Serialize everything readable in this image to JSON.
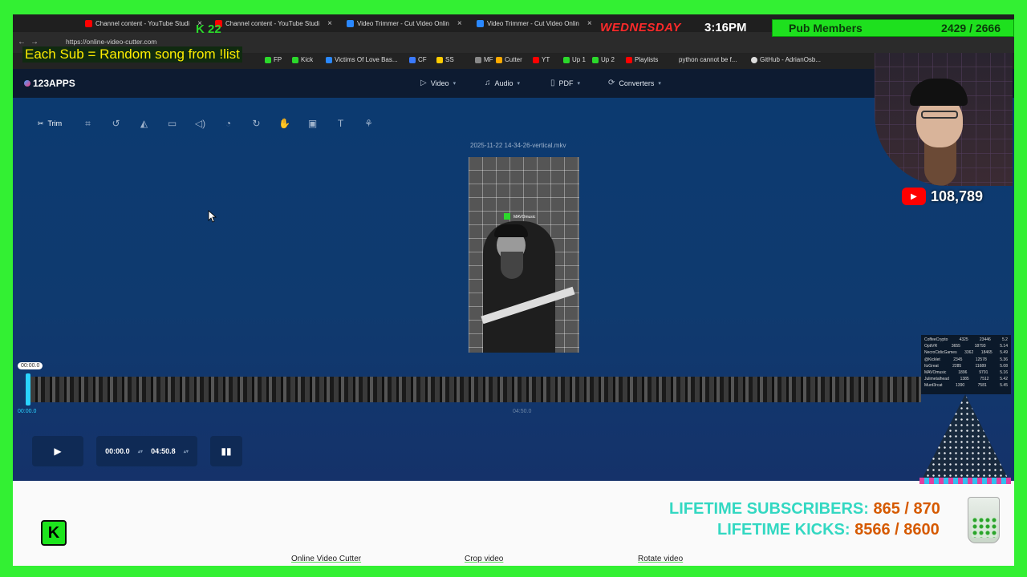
{
  "browser": {
    "tabs": [
      {
        "label": "Channel content - YouTube Studi",
        "color": "#ff0000"
      },
      {
        "label": "Channel content - YouTube Studi",
        "color": "#ff0000"
      },
      {
        "label": "Video Trimmer - Cut Video Onlin",
        "color": "#2a88ff"
      },
      {
        "label": "Video Trimmer - Cut Video Onlin",
        "color": "#2a88ff"
      }
    ],
    "url": "https://online-video-cutter.com",
    "bookmarks": [
      "FP",
      "Kick",
      "Victims Of Love Bas...",
      "CF",
      "SS",
      "MF",
      "Cutter",
      "YT",
      "Up 1",
      "Up 2",
      "Playlists",
      "python cannot be f...",
      "GitHub - AdrianOsb..."
    ]
  },
  "app": {
    "logo": "123APPS",
    "menu": [
      "Video",
      "Audio",
      "PDF",
      "Converters"
    ],
    "toolbar": {
      "trim_label": "Trim"
    },
    "filename": "2025-11-22 14-34-26-vertical.mkv",
    "timeline": {
      "bubble": "00:00.0",
      "start": "00:00.0",
      "mid": "04:50.0"
    },
    "controls": {
      "start_time": "00:00.0",
      "end_time": "04:50.8"
    },
    "preview_handle": "MAVOmusic"
  },
  "footer_links": [
    "Online Video Cutter",
    "Crop video",
    "Rotate video"
  ],
  "overlay": {
    "ticker": "Each Sub = Random song from !list",
    "kick_count": "22",
    "day": "WEDNESDAY",
    "clock": "3:16PM",
    "pub_members_label": "Pub Members",
    "pub_members_count": "2429 / 2666",
    "yt_subs": "108,789",
    "lifetime_subs_label": "LIFETIME SUBSCRIBERS:",
    "lifetime_subs_value": "865 / 870",
    "lifetime_kicks_label": "LIFETIME KICKS:",
    "lifetime_kicks_value": "8566 / 8600",
    "kick_badge": "K",
    "leaderboard": [
      {
        "name": "CoffeeCrypto",
        "a": "4325",
        "b": "23446",
        "c": "5.2"
      },
      {
        "name": "OptiVR",
        "a": "3655",
        "b": "18793",
        "c": "5.14"
      },
      {
        "name": "NecroCidicGames",
        "a": "3362",
        "b": "18465",
        "c": "5.49"
      },
      {
        "name": "@Kicklet",
        "a": "2345",
        "b": "12578",
        "c": "5.36"
      },
      {
        "name": "ItzGreat",
        "a": "2285",
        "b": "11689",
        "c": "5.08"
      },
      {
        "name": "MAVOmusic",
        "a": "1896",
        "b": "9791",
        "c": "5.16"
      },
      {
        "name": "Julimetalhead",
        "a": "1385",
        "b": "7512",
        "c": "5.42"
      },
      {
        "name": "Murd3rcat",
        "a": "1390",
        "b": "7581",
        "c": "5.45"
      }
    ]
  }
}
